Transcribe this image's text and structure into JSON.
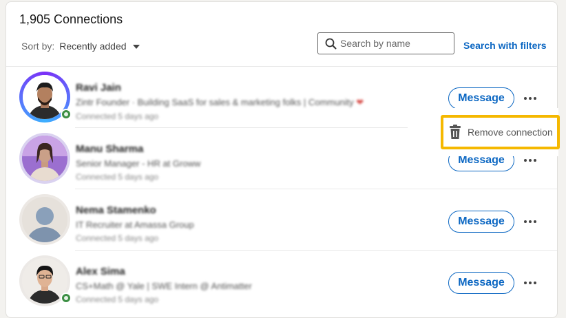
{
  "header": {
    "count_title": "1,905 Connections",
    "sort_label": "Sort by:",
    "sort_value": "Recently added",
    "search_placeholder": "Search by name",
    "search_filters": "Search with filters"
  },
  "connections": [
    {
      "name": "Ravi Jain",
      "headline": "Zintr Founder · Building SaaS for sales & marketing folks | Community",
      "connected": "Connected 5 days ago",
      "message_label": "Message",
      "has_online": true
    },
    {
      "name": "Manu Sharma",
      "headline": "Senior Manager - HR at Groww",
      "connected": "Connected 5 days ago",
      "message_label": "Message",
      "has_online": false
    },
    {
      "name": "Nema Stamenko",
      "headline": "IT Recruiter at Amassa Group",
      "connected": "Connected 5 days ago",
      "message_label": "Message",
      "has_online": false
    },
    {
      "name": "Alex Sima",
      "headline": "CS+Math @ Yale | SWE Intern @ Antimatter",
      "connected": "Connected 5 days ago",
      "message_label": "Message",
      "has_online": true
    }
  ],
  "menu": {
    "remove_label": "Remove connection"
  },
  "colors": {
    "accent": "#0a66c2",
    "highlight": "#f5b800",
    "online": "#3d8f44"
  }
}
